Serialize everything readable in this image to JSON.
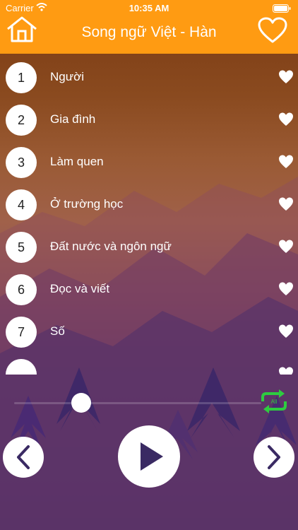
{
  "status_bar": {
    "carrier": "Carrier",
    "time": "10:35 AM",
    "wifi_icon": "wifi-icon",
    "battery_icon": "battery-icon"
  },
  "header": {
    "title": "Song ngữ Việt - Hàn",
    "home_icon": "home-icon",
    "favorites_icon": "heart-outline-icon",
    "background_color": "#ff9b12"
  },
  "lessons": [
    {
      "number": "1",
      "title": "Người"
    },
    {
      "number": "2",
      "title": "Gia đình"
    },
    {
      "number": "3",
      "title": "Làm quen"
    },
    {
      "number": "4",
      "title": "Ở trường học"
    },
    {
      "number": "5",
      "title": "Đất nước và ngôn ngữ"
    },
    {
      "number": "6",
      "title": "Đọc và viết"
    },
    {
      "number": "7",
      "title": "Số"
    }
  ],
  "player": {
    "progress_fraction": 0.27,
    "repeat_label": "All",
    "repeat_color": "#2ecc40",
    "prev_icon": "chevron-left-icon",
    "play_icon": "play-icon",
    "next_icon": "chevron-right-icon",
    "accent_color": "#3a2a63"
  }
}
